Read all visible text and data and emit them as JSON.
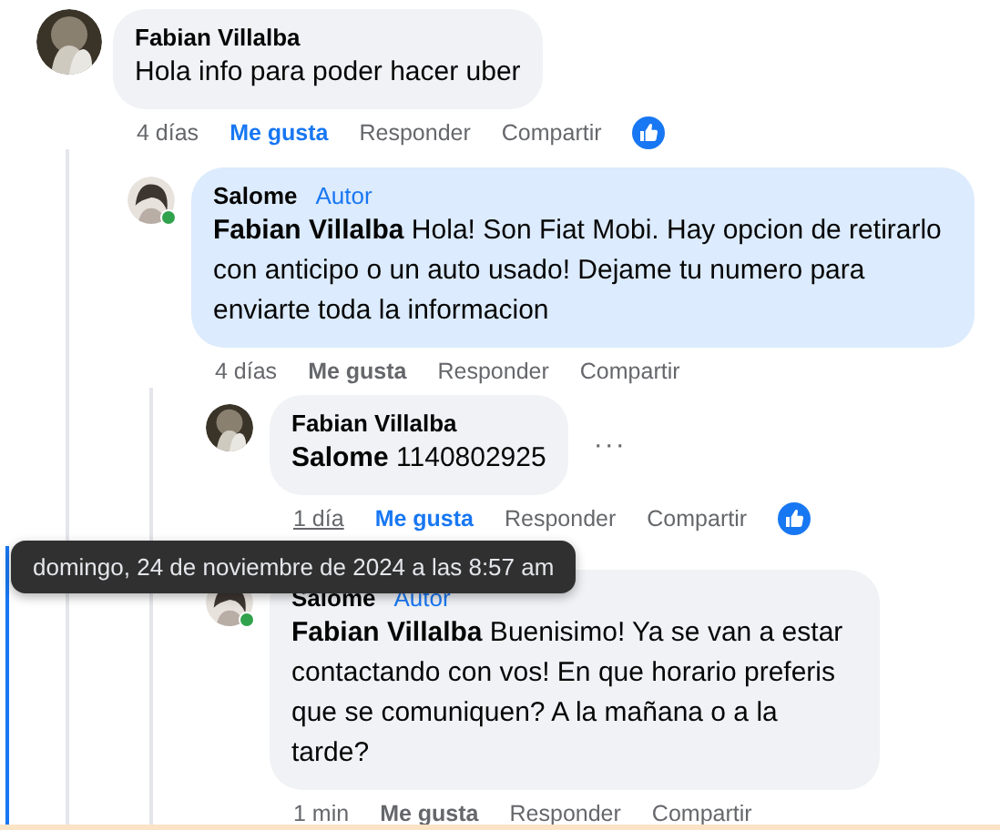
{
  "comments": [
    {
      "author": "Fabian Villalba",
      "online": false,
      "text": "Hola info para poder hacer uber",
      "time": "4 días",
      "time_hovered": false,
      "like": "Me gusta",
      "liked": true,
      "reply": "Responder",
      "share": "Compartir",
      "reacted": true,
      "highlighted": false,
      "children": [
        {
          "author": "Salome",
          "author_badge": "Autor",
          "online": true,
          "mention": "Fabian Villalba",
          "text": "Hola! Son Fiat Mobi. Hay opcion de retirarlo con anticipo o un auto usado! Dejame tu numero para enviarte toda la informacion",
          "time": "4 días",
          "time_hovered": false,
          "like": "Me gusta",
          "liked": false,
          "reply": "Responder",
          "share": "Compartir",
          "reacted": false,
          "highlighted": true,
          "children": [
            {
              "author": "Fabian Villalba",
              "online": false,
              "mention": "Salome",
              "text": "1140802925",
              "more": "···",
              "time": "1 día",
              "time_hovered": true,
              "like": "Me gusta",
              "liked": true,
              "reply": "Responder",
              "share": "Compartir",
              "reacted": true,
              "highlighted": false
            },
            {
              "author": "Salome",
              "author_badge": "Autor",
              "online": true,
              "mention": "Fabian Villalba",
              "text": "Buenisimo! Ya se van a estar contactando con vos! En que horario preferis que se comuniquen? A la mañana o a la tarde?",
              "time": "1 min",
              "time_hovered": false,
              "like": "Me gusta",
              "liked": false,
              "reply": "Responder",
              "share": "Compartir",
              "reacted": false,
              "highlighted": false
            }
          ]
        }
      ]
    }
  ],
  "tooltip": {
    "text": "domingo, 24 de noviembre de 2024 a las 8:57 am"
  }
}
